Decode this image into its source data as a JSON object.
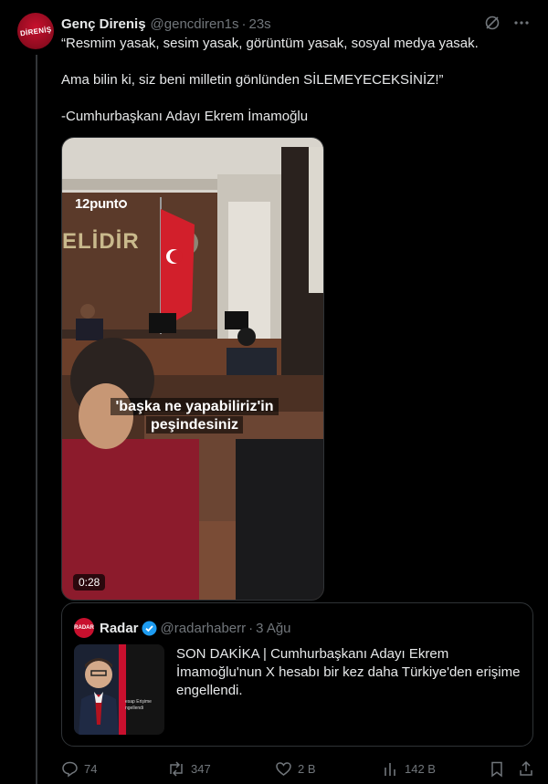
{
  "tweet": {
    "author_name": "Genç Direniş",
    "handle": "@gencdiren1s",
    "separator": "·",
    "time": "23s",
    "avatar_text": "DİRENİŞ",
    "paragraphs": [
      "“Resmim yasak, sesim yasak, görüntüm yasak, sosyal medya yasak.",
      "Ama bilin ki, siz beni milletin gönlünden SİLEMEYECEKSİNİZ!”",
      "-Cumhurbaşkanı Adayı Ekrem İmamoğlu"
    ]
  },
  "video": {
    "brand": "12punt",
    "sign_text": "ELİDİR",
    "subtitle_line1": "'başka ne yapabiliriz'in",
    "subtitle_line2": "peşindesiniz",
    "duration": "0:28"
  },
  "quote": {
    "avatar_text": "RADAR",
    "author_name": "Radar",
    "handle": "@radarhaberr",
    "separator": "·",
    "date": "3 Ağu",
    "text": "SON DAKİKA | Cumhurbaşkanı Adayı Ekrem İmamoğlu'nun X hesabı bir kez daha Türkiye'den erişime engellendi.",
    "thumb_caption": "esap Erişime ngellendi"
  },
  "actions": {
    "replies": "74",
    "reposts": "347",
    "likes": "2 B",
    "views": "142 B"
  },
  "colors": {
    "background": "#000000",
    "text": "#e7e9ea",
    "muted": "#71767b",
    "border": "#2f3336",
    "verified": "#1d9bf0"
  }
}
